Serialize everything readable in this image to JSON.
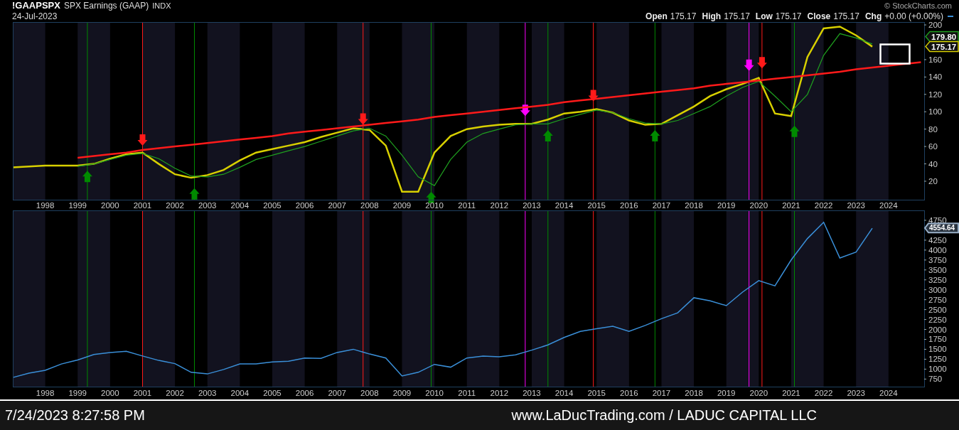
{
  "header": {
    "symbol": "!GAAPSPX",
    "name": "SPX Earnings (GAAP)",
    "exchange": "INDX",
    "date": "24-Jul-2023",
    "copyright": "© StockCharts.com",
    "quote": [
      {
        "label": "Open",
        "value": "175.17"
      },
      {
        "label": "High",
        "value": "175.17"
      },
      {
        "label": "Low",
        "value": "175.17"
      },
      {
        "label": "Close",
        "value": "175.17"
      },
      {
        "label": "Chg",
        "value": "+0.00 (+0.00%)"
      }
    ]
  },
  "earnings_panel": {
    "price_tags": [
      {
        "label": "179.80",
        "color": "#1fa01f"
      },
      {
        "label": "175.17",
        "color": "#d8d000"
      }
    ],
    "chart_data": {
      "type": "line",
      "x": [
        1997,
        1997.5,
        1998,
        1998.5,
        1999,
        1999.5,
        2000,
        2000.5,
        2001,
        2001.5,
        2002,
        2002.5,
        2003,
        2003.5,
        2004,
        2004.5,
        2005,
        2005.5,
        2006,
        2006.5,
        2007,
        2007.5,
        2008,
        2008.5,
        2009,
        2009.5,
        2010,
        2010.5,
        2011,
        2011.5,
        2012,
        2012.5,
        2013,
        2013.5,
        2014,
        2014.5,
        2015,
        2015.5,
        2016,
        2016.5,
        2017,
        2017.5,
        2018,
        2018.5,
        2019,
        2019.5,
        2020,
        2020.5,
        2021,
        2021.5,
        2022,
        2022.5,
        2023,
        2023.5,
        2024,
        2024.5,
        2025
      ],
      "series": [
        {
          "color": "#d8d000",
          "values": [
            36,
            37,
            38,
            38,
            38,
            40,
            46,
            51,
            53,
            40,
            28,
            24,
            27,
            33,
            44,
            53,
            57,
            61,
            65,
            71,
            76,
            81,
            79,
            61,
            8,
            8,
            53,
            72,
            80,
            83,
            85,
            86,
            86,
            91,
            98,
            100,
            103,
            99,
            90,
            85,
            86,
            96,
            106,
            118,
            126,
            132,
            139,
            98,
            95,
            163,
            196,
            198,
            188,
            175,
            null,
            null,
            null
          ]
        },
        {
          "color": "#1fa01f",
          "values": [
            null,
            null,
            null,
            null,
            37,
            40,
            45,
            50,
            52,
            46,
            35,
            26,
            25,
            28,
            36,
            45,
            50,
            55,
            60,
            66,
            72,
            78,
            81,
            72,
            50,
            25,
            15,
            45,
            65,
            75,
            80,
            85,
            86,
            86,
            92,
            97,
            102,
            99,
            92,
            87,
            86,
            90,
            98,
            106,
            118,
            128,
            135,
            118,
            100,
            120,
            165,
            190,
            185,
            178,
            null,
            null,
            null
          ]
        },
        {
          "color": "#ff1a1a",
          "values": [
            null,
            null,
            null,
            null,
            47,
            49,
            51,
            53,
            56,
            58,
            60,
            62,
            64,
            66,
            68,
            70,
            72,
            75,
            77,
            79,
            81,
            83,
            85,
            87,
            89,
            91,
            94,
            96,
            98,
            100,
            102,
            104,
            106,
            108,
            111,
            113,
            115,
            117,
            119,
            121,
            123,
            125,
            127,
            130,
            132,
            134,
            136,
            138,
            140,
            142,
            144,
            146,
            149,
            151,
            153,
            155,
            157
          ]
        }
      ],
      "xlim": [
        1997,
        2025.1
      ],
      "ylim": [
        -2.1,
        203.3
      ],
      "ref_lines": [
        {
          "axis": "x",
          "value": 1999.3,
          "color": "#008a00"
        },
        {
          "axis": "x",
          "value": 2001.0,
          "color": "#ff1a1a"
        },
        {
          "axis": "x",
          "value": 2002.6,
          "color": "#008a00"
        },
        {
          "axis": "x",
          "value": 2007.8,
          "color": "#ff1a1a"
        },
        {
          "axis": "x",
          "value": 2009.9,
          "color": "#008a00"
        },
        {
          "axis": "x",
          "value": 2012.8,
          "color": "#ff00ff"
        },
        {
          "axis": "x",
          "value": 2013.5,
          "color": "#008a00"
        },
        {
          "axis": "x",
          "value": 2014.9,
          "color": "#ff1a1a"
        },
        {
          "axis": "x",
          "value": 2016.8,
          "color": "#008a00"
        },
        {
          "axis": "x",
          "value": 2019.7,
          "color": "#ff00ff"
        },
        {
          "axis": "x",
          "value": 2020.1,
          "color": "#ff1a1a"
        },
        {
          "axis": "x",
          "value": 2021.1,
          "color": "#008a00"
        }
      ],
      "xticks": [
        1998,
        1999,
        2000,
        2001,
        2002,
        2003,
        2004,
        2005,
        2006,
        2007,
        2008,
        2009,
        2010,
        2011,
        2012,
        2013,
        2014,
        2015,
        2016,
        2017,
        2018,
        2019,
        2020,
        2021,
        2022,
        2023,
        2024
      ],
      "yticks": [
        20,
        40,
        60,
        80,
        100,
        120,
        140,
        160,
        200
      ]
    }
  },
  "index_panel": {
    "price_tags": [
      {
        "label": "4554.64",
        "color": "#9ab0c8"
      }
    ],
    "chart_data": {
      "type": "line",
      "x": [
        1997,
        1997.5,
        1998,
        1998.5,
        1999,
        1999.5,
        2000,
        2000.5,
        2001,
        2001.5,
        2002,
        2002.5,
        2003,
        2003.5,
        2004,
        2004.5,
        2005,
        2005.5,
        2006,
        2006.5,
        2007,
        2007.5,
        2008,
        2008.5,
        2009,
        2009.5,
        2010,
        2010.5,
        2011,
        2011.5,
        2012,
        2012.5,
        2013,
        2013.5,
        2014,
        2014.5,
        2015,
        2015.5,
        2016,
        2016.5,
        2017,
        2017.5,
        2018,
        2018.5,
        2019,
        2019.5,
        2020,
        2020.5,
        2021,
        2021.5,
        2022,
        2022.5,
        2023,
        2023.5
      ],
      "series": [
        {
          "color": "#3a8fd8",
          "values": [
            790,
            900,
            970,
            1130,
            1230,
            1370,
            1420,
            1450,
            1330,
            1220,
            1140,
            920,
            880,
            990,
            1130,
            1130,
            1180,
            1200,
            1280,
            1270,
            1420,
            1500,
            1380,
            1280,
            830,
            920,
            1120,
            1050,
            1280,
            1330,
            1310,
            1360,
            1480,
            1610,
            1800,
            1950,
            2020,
            2080,
            1950,
            2100,
            2270,
            2420,
            2800,
            2720,
            2600,
            2940,
            3230,
            3100,
            3750,
            4290,
            4700,
            3800,
            3950,
            4550
          ]
        }
      ],
      "xlim": [
        1997,
        2025.1
      ],
      "ylim": [
        541,
        5000
      ],
      "ref_lines": [
        {
          "axis": "x",
          "value": 1999.3,
          "color": "#008a00"
        },
        {
          "axis": "x",
          "value": 2001.0,
          "color": "#ff1a1a"
        },
        {
          "axis": "x",
          "value": 2002.6,
          "color": "#008a00"
        },
        {
          "axis": "x",
          "value": 2007.8,
          "color": "#ff1a1a"
        },
        {
          "axis": "x",
          "value": 2009.9,
          "color": "#008a00"
        },
        {
          "axis": "x",
          "value": 2012.8,
          "color": "#ff00ff"
        },
        {
          "axis": "x",
          "value": 2013.5,
          "color": "#008a00"
        },
        {
          "axis": "x",
          "value": 2014.9,
          "color": "#ff1a1a"
        },
        {
          "axis": "x",
          "value": 2016.8,
          "color": "#008a00"
        },
        {
          "axis": "x",
          "value": 2019.7,
          "color": "#ff00ff"
        },
        {
          "axis": "x",
          "value": 2020.1,
          "color": "#ff1a1a"
        },
        {
          "axis": "x",
          "value": 2021.1,
          "color": "#008a00"
        }
      ],
      "xticks": [
        1998,
        1999,
        2000,
        2001,
        2002,
        2003,
        2004,
        2005,
        2006,
        2007,
        2008,
        2009,
        2010,
        2011,
        2012,
        2013,
        2014,
        2015,
        2016,
        2017,
        2018,
        2019,
        2020,
        2021,
        2022,
        2023,
        2024
      ],
      "yticks": [
        750,
        1000,
        1250,
        1500,
        1750,
        2000,
        2250,
        2500,
        2750,
        3000,
        3250,
        3500,
        3750,
        4000,
        4250,
        4750
      ]
    }
  },
  "footer": {
    "timestamp": "7/24/2023 8:27:58 PM",
    "credit": "www.LaDucTrading.com / LADUC CAPITAL LLC"
  }
}
